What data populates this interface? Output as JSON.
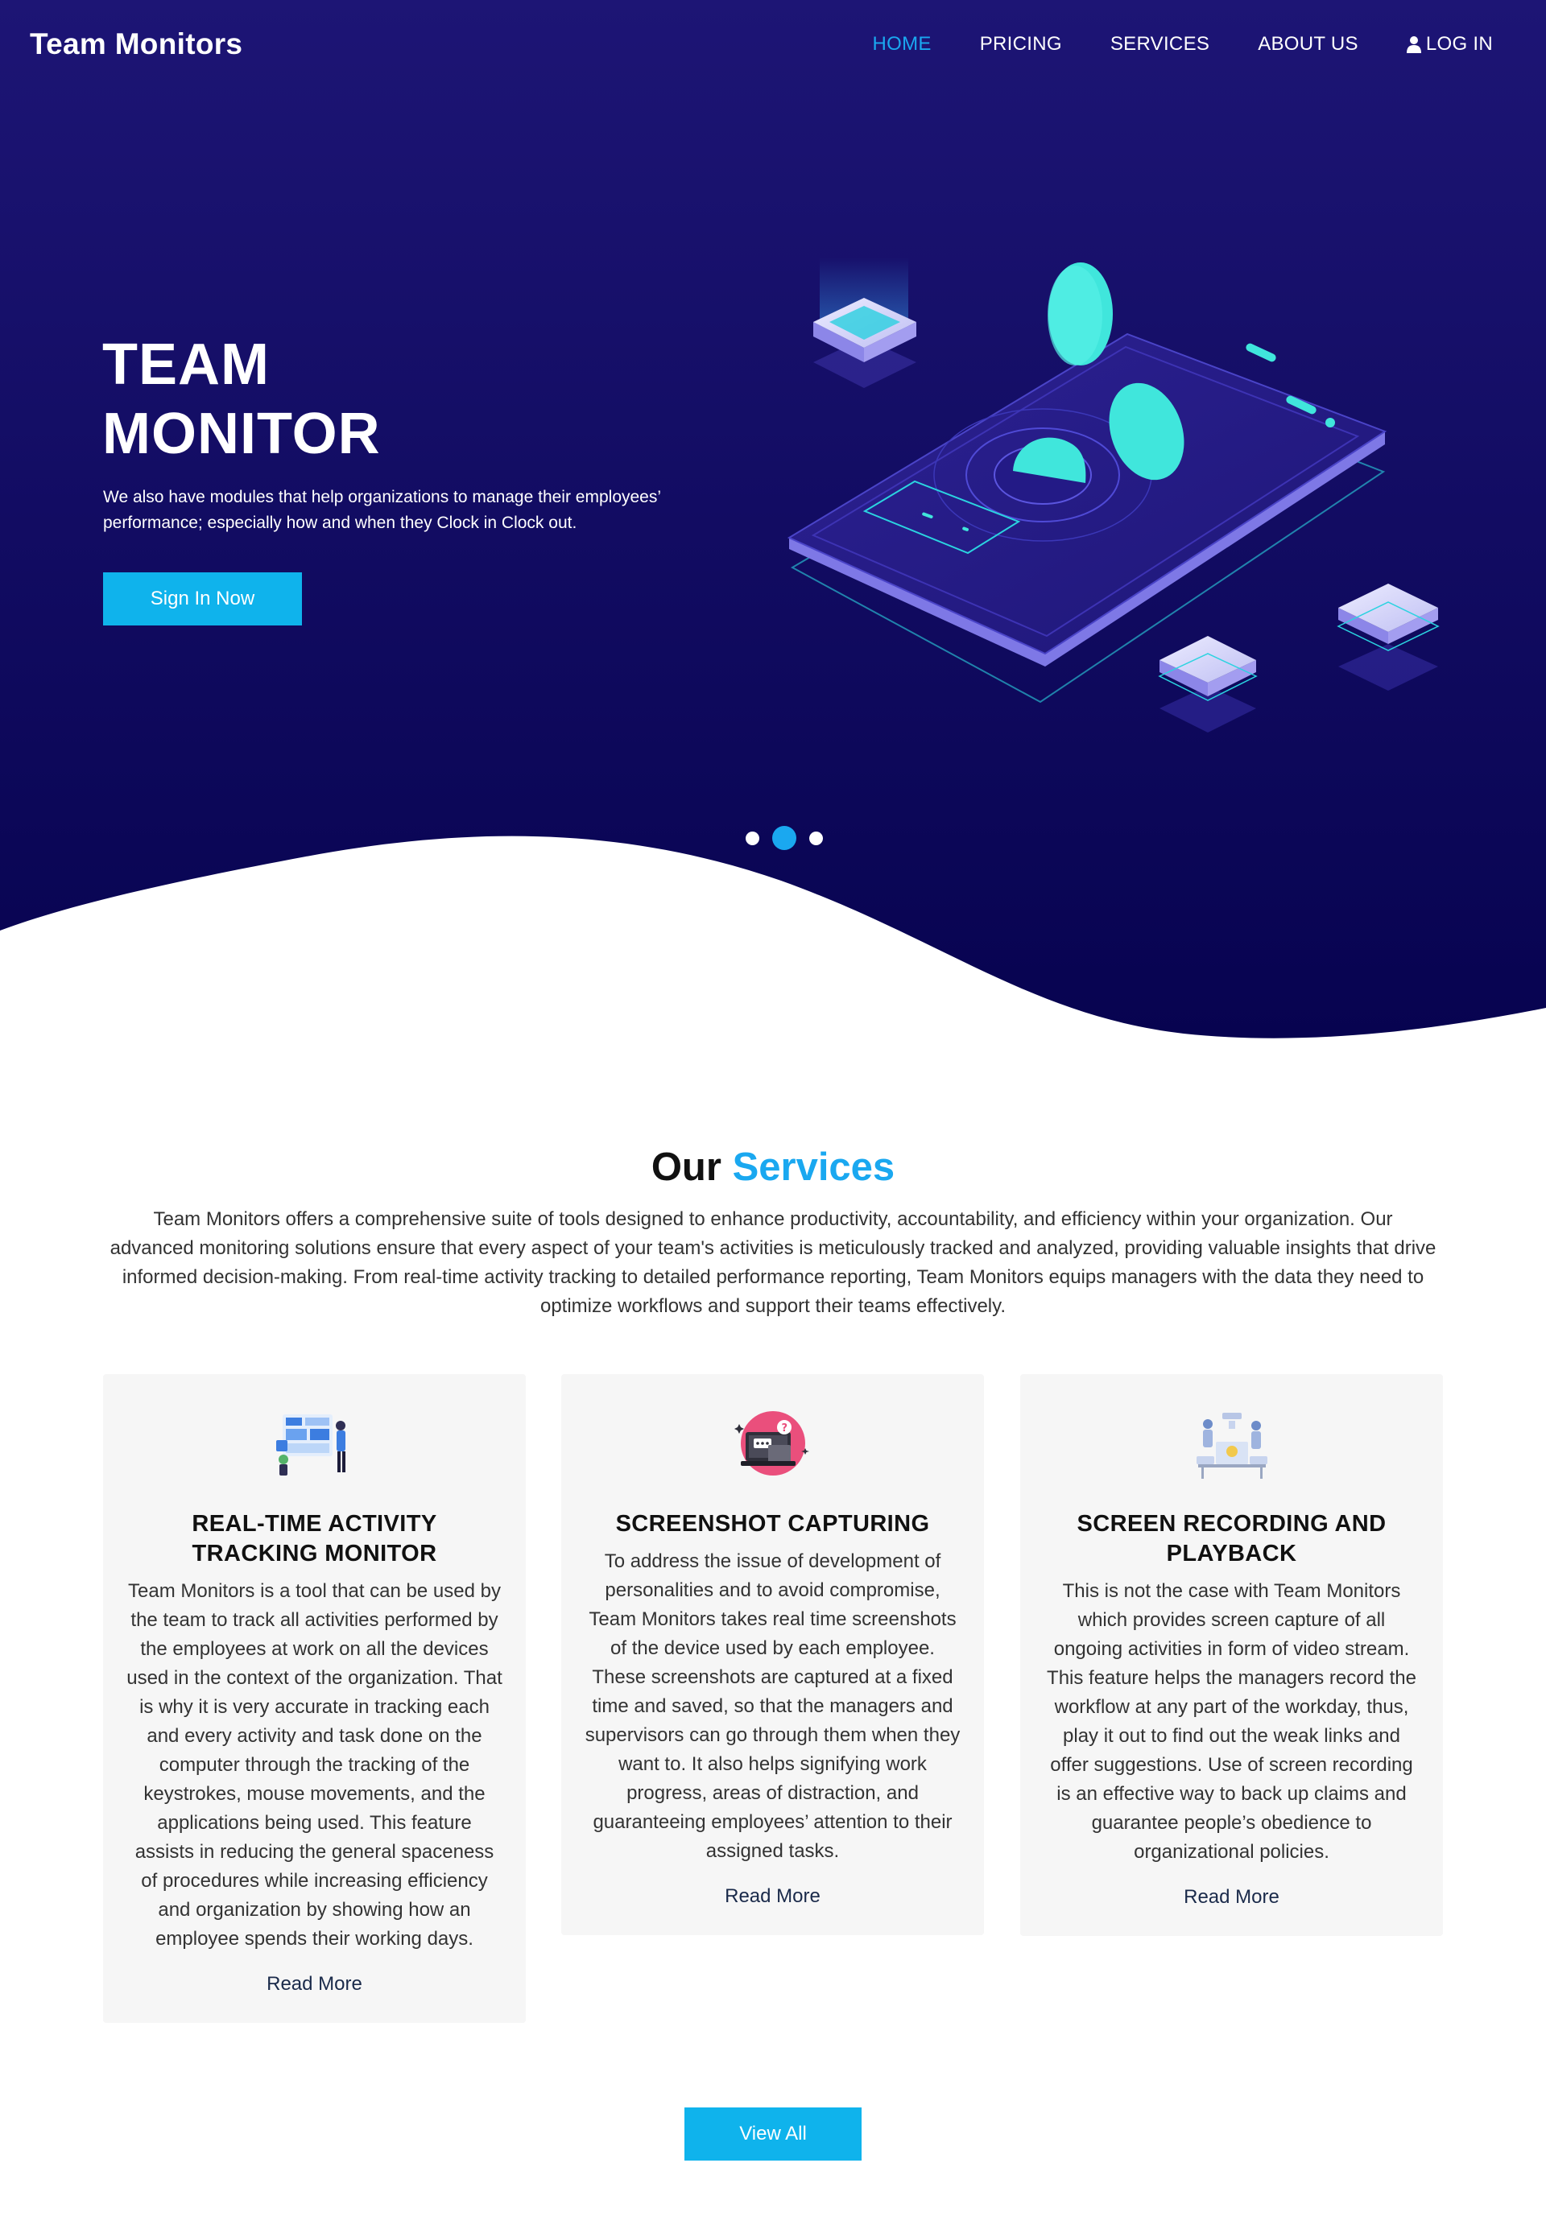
{
  "brand": "Team Monitors",
  "nav": {
    "items": [
      {
        "label": "HOME",
        "active": true
      },
      {
        "label": "PRICING",
        "active": false
      },
      {
        "label": "SERVICES",
        "active": false
      },
      {
        "label": "ABOUT US",
        "active": false
      }
    ],
    "login_label": "LOG IN"
  },
  "hero": {
    "title_line1": "TEAM",
    "title_line2": "MONITOR",
    "description": "We also have modules that help organizations to manage their employees’ performance; especially how and when they Clock in Clock out.",
    "button_label": "Sign In Now",
    "carousel": {
      "slides": 3,
      "active_index": 1
    }
  },
  "services": {
    "title_plain": "Our",
    "title_accent": "Services",
    "intro": "Team Monitors offers a comprehensive suite of tools designed to enhance productivity, accountability, and efficiency within your organization. Our advanced monitoring solutions ensure that every aspect of your team's activities is meticulously tracked and analyzed, providing valuable insights that drive informed decision-making. From real-time activity tracking to detailed performance reporting, Team Monitors equips managers with the data they need to optimize workflows and support their teams effectively.",
    "cards": [
      {
        "icon": "activity-dashboard-icon",
        "title": "REAL-TIME ACTIVITY TRACKING MONITOR",
        "text": "Team Monitors is a tool that can be used by the team to track all activities performed by the employees at work on all the devices used in the context of the organization. That is why it is very accurate in tracking each and every activity and task done on the computer through the tracking of the keystrokes, mouse movements, and the applications being used. This feature assists in reducing the general spaceness of procedures while increasing efficiency and organization by showing how an employee spends their working days.",
        "link": "Read More"
      },
      {
        "icon": "screenshot-laptop-icon",
        "title": "SCREENSHOT CAPTURING",
        "text": "To address the issue of development of personalities and to avoid compromise, Team Monitors takes real time screenshots of the device used by each employee. These screenshots are captured at a fixed time and saved, so that the managers and supervisors can go through them when they want to. It also helps signifying work progress, areas of distraction, and guaranteeing employees’ attention to their assigned tasks.",
        "link": "Read More"
      },
      {
        "icon": "screen-recording-icon",
        "title": "SCREEN RECORDING AND PLAYBACK",
        "text": "This is not the case with Team Monitors which provides screen capture of all ongoing activities in form of video stream. This feature helps the managers record the workflow at any part of the workday, thus, play it out to find out the weak links and offer suggestions. Use of screen recording is an effective way to back up claims and guarantee people’s obedience to organizational policies.",
        "link": "Read More"
      }
    ],
    "view_all_label": "View All"
  },
  "colors": {
    "hero_top": "#1a1470",
    "hero_bottom": "#080452",
    "accent": "#1aa8f0",
    "button": "#0fb3ec",
    "card_bg": "#f6f6f6"
  }
}
